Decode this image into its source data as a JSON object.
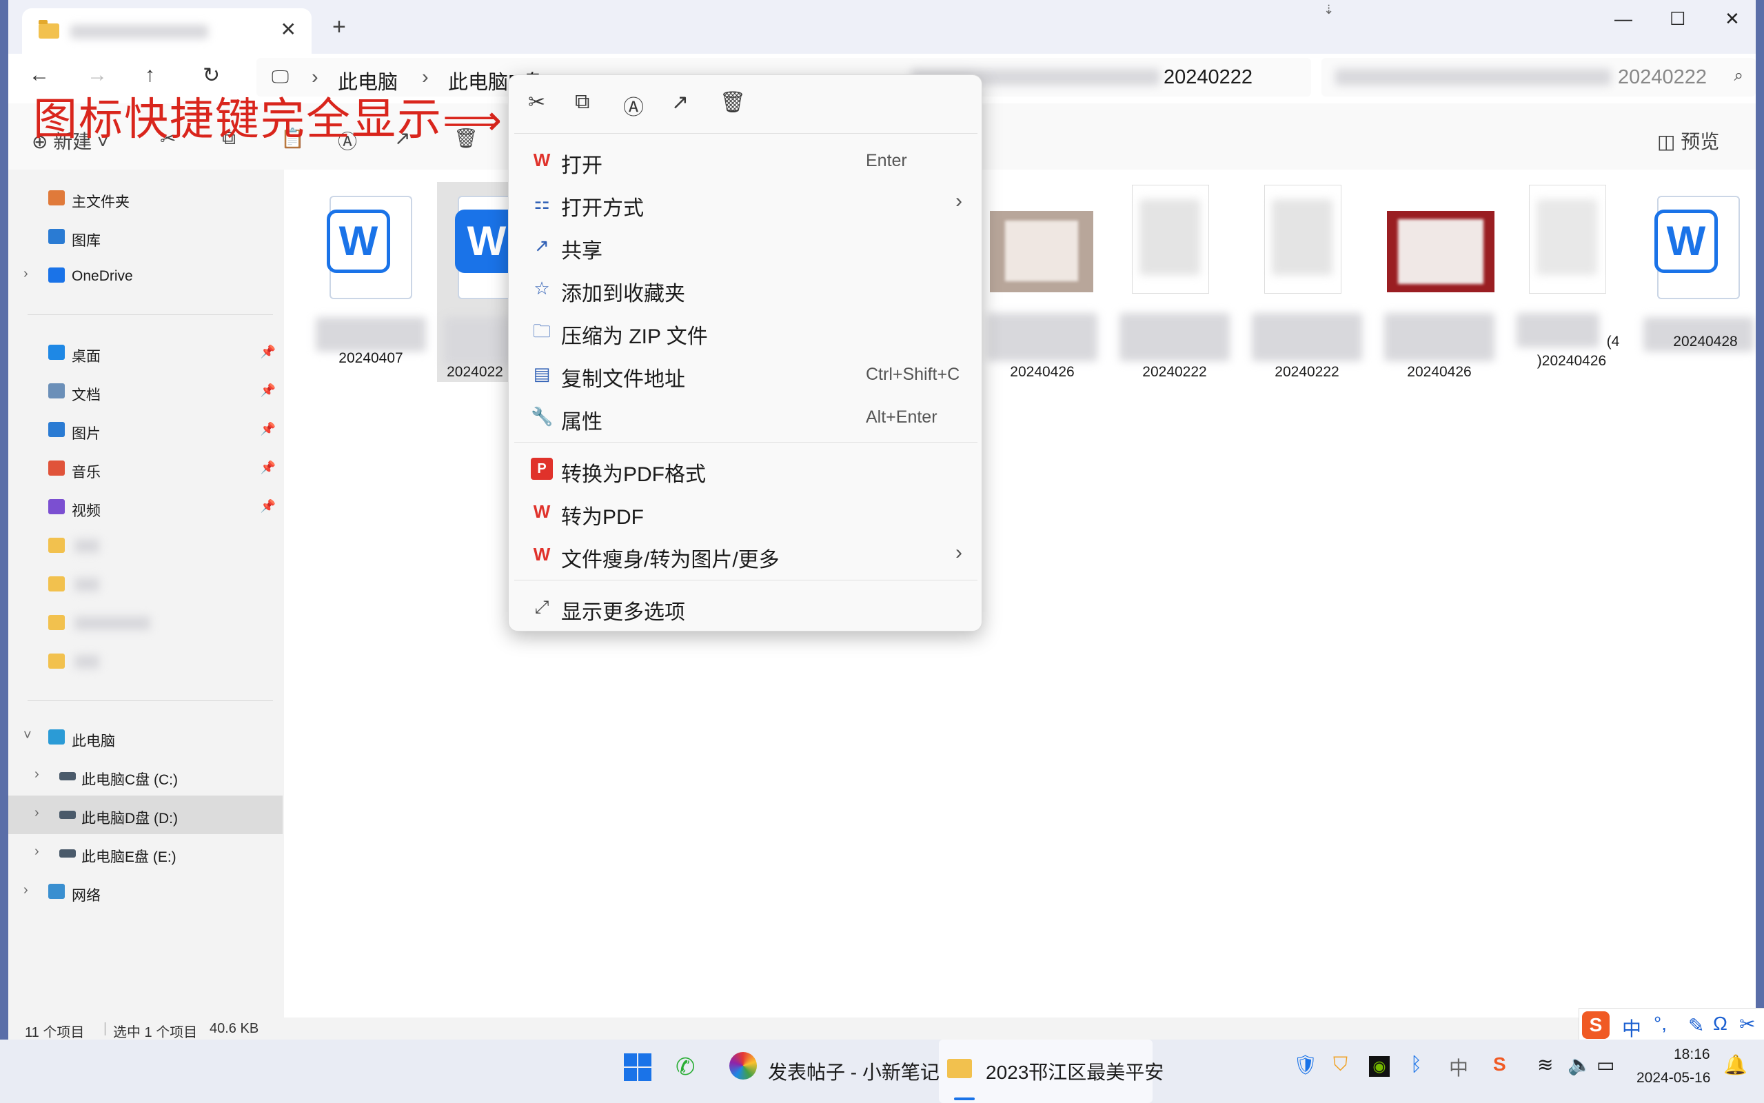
{
  "window": {
    "tab_close": "✕",
    "new_tab": "+",
    "controls": [
      "—",
      "☐",
      "✕"
    ]
  },
  "nav": {
    "back": "←",
    "forward": "→",
    "up": "↑",
    "refresh": "↻",
    "breadcrumb": [
      "此电脑",
      "此电脑D盘 (D:",
      "20240222"
    ],
    "search_suffix": "20240222"
  },
  "toolbar": {
    "new_label": "新建",
    "preview_label": "预览"
  },
  "annotation": "图标快捷键完全显示",
  "sidebar": {
    "top": [
      {
        "label": "主文件夹",
        "icon": "home-icon",
        "color": "#e07a3a"
      },
      {
        "label": "图库",
        "icon": "gallery-icon",
        "color": "#2a7bd3"
      },
      {
        "label": "OneDrive",
        "icon": "cloud-icon",
        "color": "#1a73e8"
      }
    ],
    "pinned": [
      {
        "label": "桌面",
        "icon": "desktop-icon",
        "color": "#1e88e5"
      },
      {
        "label": "文档",
        "icon": "documents-icon",
        "color": "#6b8fb8"
      },
      {
        "label": "图片",
        "icon": "pictures-icon",
        "color": "#2a7bd3"
      },
      {
        "label": "音乐",
        "icon": "music-icon",
        "color": "#e0533a"
      },
      {
        "label": "视频",
        "icon": "video-icon",
        "color": "#7b4fd1"
      }
    ],
    "computer": [
      {
        "label": "此电脑",
        "icon": "computer-icon"
      },
      {
        "label": "此电脑C盘 (C:)",
        "icon": "drive-icon"
      },
      {
        "label": "此电脑D盘 (D:)",
        "icon": "drive-icon"
      },
      {
        "label": "此电脑E盘 (E:)",
        "icon": "drive-icon"
      },
      {
        "label": "网络",
        "icon": "network-icon"
      }
    ]
  },
  "files": [
    {
      "name": "20240407",
      "type": "word"
    },
    {
      "name": "2024022",
      "type": "word"
    },
    {
      "name": "20240426",
      "type": "photo"
    },
    {
      "name": "20240222",
      "type": "doc"
    },
    {
      "name": "20240222",
      "type": "doc"
    },
    {
      "name": "20240426",
      "type": "photo"
    },
    {
      "name": ")20240426",
      "extra": "(4",
      "type": "doc"
    },
    {
      "name": "20240428",
      "type": "word"
    }
  ],
  "status": {
    "count": "11 个项目",
    "selected": "选中 1 个项目",
    "size": "40.6 KB"
  },
  "context_menu": {
    "top_icons": [
      "cut-icon",
      "copy-icon",
      "rename-icon",
      "share-icon",
      "delete-icon"
    ],
    "items": [
      {
        "label": "打开",
        "shortcut": "Enter",
        "icon": "wps-icon"
      },
      {
        "label": "打开方式",
        "shortcut": "",
        "icon": "open-with-icon",
        "submenu": true
      },
      {
        "label": "共享",
        "shortcut": "",
        "icon": "share-icon"
      },
      {
        "label": "添加到收藏夹",
        "shortcut": "",
        "icon": "star-icon"
      },
      {
        "label": "压缩为 ZIP 文件",
        "shortcut": "",
        "icon": "zip-icon"
      },
      {
        "label": "复制文件地址",
        "shortcut": "Ctrl+Shift+C",
        "icon": "copy-path-icon"
      },
      {
        "label": "属性",
        "shortcut": "Alt+Enter",
        "icon": "wrench-icon"
      },
      {
        "label": "转换为PDF格式",
        "shortcut": "",
        "icon": "pdf-icon"
      },
      {
        "label": "转为PDF",
        "shortcut": "",
        "icon": "wps-icon"
      },
      {
        "label": "文件瘦身/转为图片/更多",
        "shortcut": "",
        "icon": "wps-icon",
        "submenu": true
      },
      {
        "label": "显示更多选项",
        "shortcut": "",
        "icon": "more-options-icon"
      }
    ]
  },
  "taskbar": {
    "app1": "发表帖子 - 小新笔记",
    "app2": "2023邗江区最美平安",
    "ime_tray": "中",
    "time": "18:16",
    "date": "2024-05-16"
  },
  "ime_bar": {
    "lang": "中",
    "punct": "°,"
  }
}
